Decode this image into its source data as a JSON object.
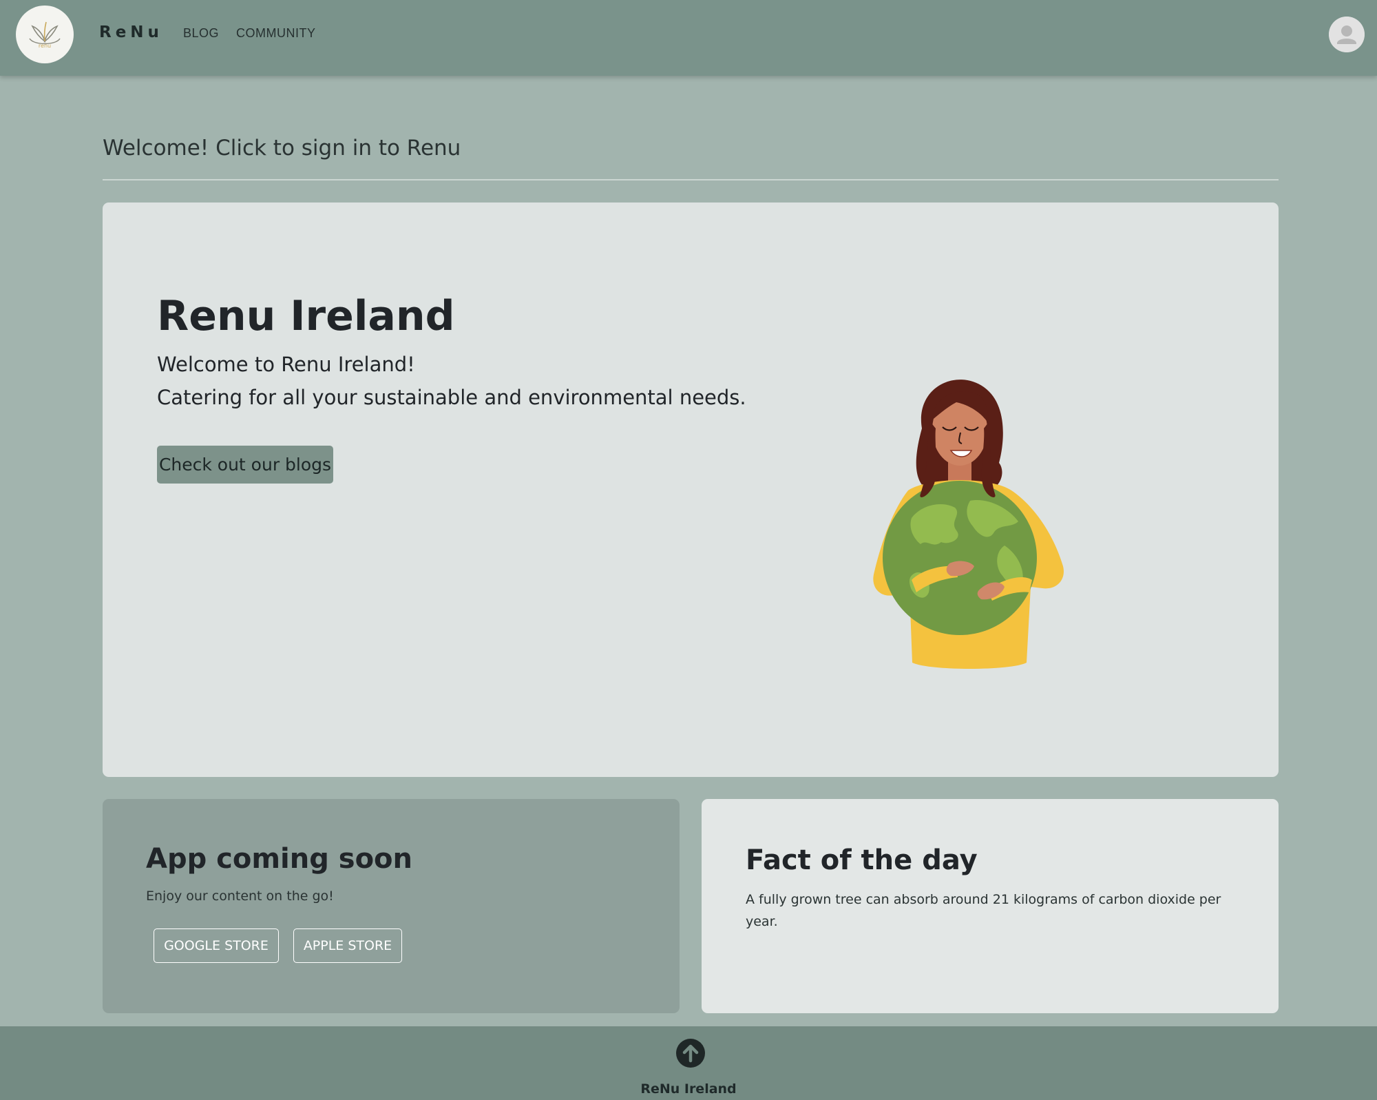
{
  "nav": {
    "logo_text": "renu",
    "brand": "ReNu",
    "links": [
      "BLOG",
      "COMMUNITY"
    ]
  },
  "welcome": "Welcome! Click to sign in to Renu",
  "hero": {
    "title": "Renu Ireland",
    "line1": "Welcome to Renu Ireland!",
    "line2": "Catering for all your sustainable and environmental needs.",
    "button": "Check out our blogs"
  },
  "app_card": {
    "title": "App coming soon",
    "subtitle": "Enjoy our content on the go!",
    "buttons": [
      "GOOGLE STORE",
      "APPLE STORE"
    ]
  },
  "fact_card": {
    "title": "Fact of the day",
    "text": "A fully grown tree can absorb around 21 kilograms of carbon dioxide per year."
  },
  "footer": {
    "text": "ReNu Ireland"
  },
  "icons": {
    "logo": "renu-logo-icon",
    "avatar": "user-avatar-icon",
    "illustration": "woman-hugging-earth-illustration",
    "back_to_top": "arrow-up-circle-icon"
  },
  "colors": {
    "navbar": "#7a938b",
    "background": "#a2b4ae",
    "hero_card": "#dee3e2",
    "app_card": "#8fa09b",
    "fact_card": "#e3e7e6",
    "button": "#7d928a",
    "footer": "#748b83"
  }
}
